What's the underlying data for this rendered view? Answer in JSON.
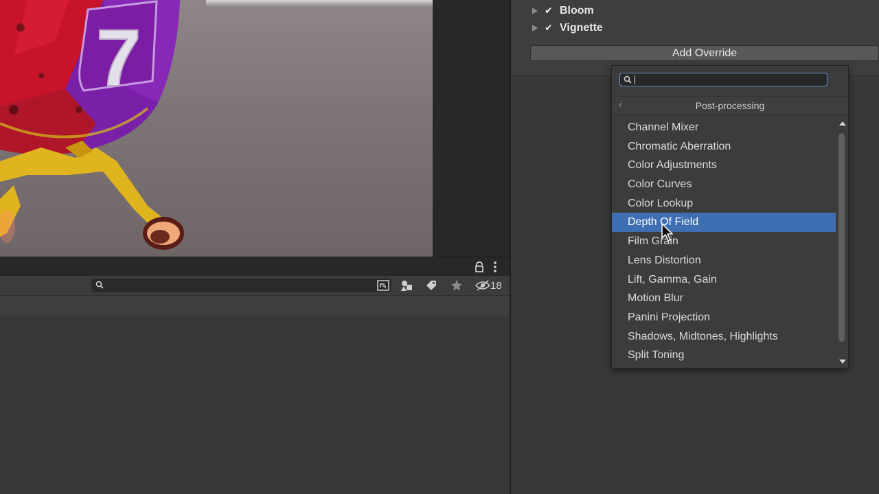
{
  "scene": {
    "rocket_number": "7"
  },
  "project_panel": {
    "search_placeholder": "",
    "hidden_count": "18",
    "icons": [
      "lock-icon",
      "menu-dots-icon",
      "search-icon",
      "scene-view-icon",
      "filter-type-icon",
      "label-tag-icon",
      "favorite-star-icon",
      "hidden-eye-icon"
    ]
  },
  "inspector": {
    "overrides": [
      {
        "label": "Bloom",
        "enabled": true
      },
      {
        "label": "Vignette",
        "enabled": true
      }
    ],
    "add_override_label": "Add Override"
  },
  "popup": {
    "search_value": "",
    "header_title": "Post-processing",
    "back_glyph": "‹",
    "selected_index": 5,
    "items": [
      "Channel Mixer",
      "Chromatic Aberration",
      "Color Adjustments",
      "Color Curves",
      "Color Lookup",
      "Depth Of Field",
      "Film Grain",
      "Lens Distortion",
      "Lift, Gamma, Gain",
      "Motion Blur",
      "Panini Projection",
      "Shadows, Midtones, Highlights",
      "Split Toning"
    ]
  },
  "colors": {
    "selection": "#3e6fb2",
    "search_focus_border": "#5b8fd3",
    "rocket_red": "#c8142a",
    "rocket_purple": "#7a1fa8",
    "landing_leg_yellow": "#e0b41e"
  }
}
